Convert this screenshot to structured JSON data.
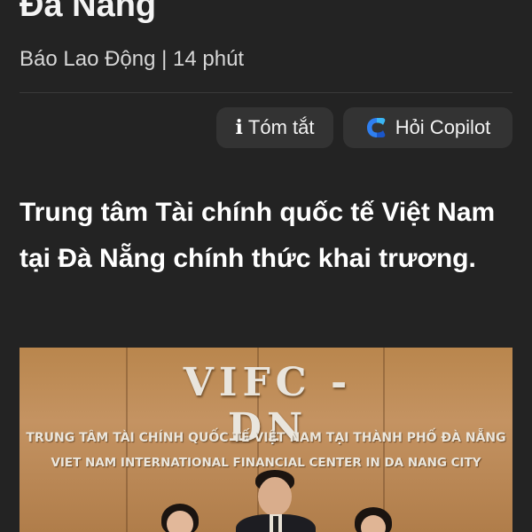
{
  "article": {
    "title_partial": "Đà Nẵng",
    "meta": "Báo Lao Động | 14 phút",
    "headline": "Trung tâm Tài chính quốc tế Việt Nam tại Đà Nẵng chính thức khai trương."
  },
  "actions": {
    "summary_label": "Tóm tắt",
    "summary_icon": "info-icon",
    "copilot_label": "Hỏi Copilot",
    "copilot_icon": "copilot-icon",
    "copilot_colors": [
      "#3d8ef7",
      "#1f5fd6",
      "#36c0f0"
    ]
  },
  "photo": {
    "sign_title": "VIFC - DN",
    "sign_line_vi": "TRUNG TÂM TÀI CHÍNH QUỐC TẾ VIỆT NAM TẠI THÀNH PHỐ ĐÀ NẴNG",
    "sign_line_en": "VIET NAM INTERNATIONAL FINANCIAL CENTER IN DA NANG CITY"
  },
  "colors": {
    "background": "#232323",
    "button_bg": "#333333",
    "meta_text": "#d6d6d6"
  }
}
